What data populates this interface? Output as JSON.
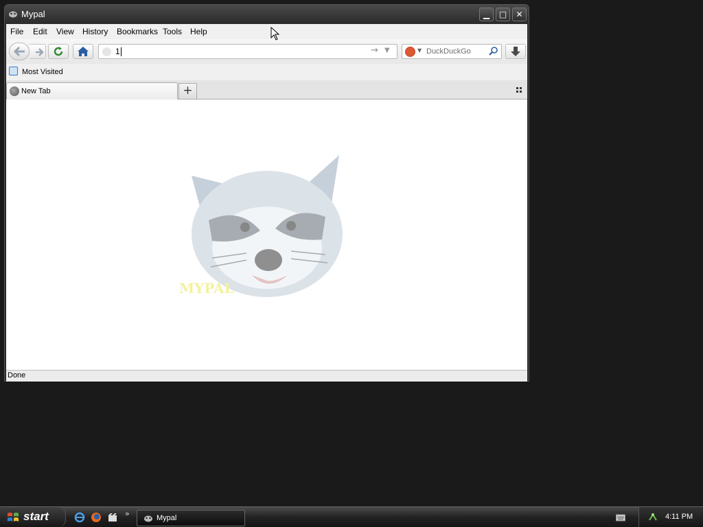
{
  "window": {
    "title": "Mypal",
    "minimize_glyph": "▁",
    "maximize_glyph": "□",
    "close_glyph": "✕"
  },
  "menu": [
    "File",
    "Edit",
    "View",
    "History",
    "Bookmarks",
    "Tools",
    "Help"
  ],
  "toolbar": {
    "url_value": "1",
    "search_placeholder": "DuckDuckGo",
    "icons": [
      "back-icon",
      "forward-icon",
      "reload-icon",
      "home-icon",
      "download-icon"
    ]
  },
  "bookmarks_bar": {
    "items": [
      "Most Visited"
    ]
  },
  "tabs": [
    {
      "label": "New Tab"
    }
  ],
  "new_tab_glyph": "+",
  "content": {
    "logo_text": "MYPAL"
  },
  "status": "Done",
  "taskbar": {
    "start_label": "start",
    "more_glyph": "»",
    "task_label": "Mypal",
    "clock": "4:11 PM"
  }
}
